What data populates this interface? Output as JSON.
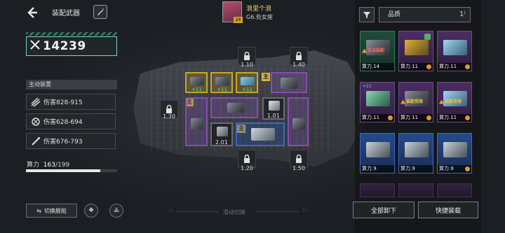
{
  "header": {
    "back_icon": "back-arrow-icon",
    "title": "装配武器",
    "action_icon": "pen-icon"
  },
  "power": {
    "value": "14239",
    "icon": "crossed-swords-icon"
  },
  "gear": {
    "title": "主动装置",
    "items": [
      {
        "label": "伤害828-915",
        "icon": "triple-missile-icon"
      },
      {
        "label": "伤害628-694",
        "icon": "claw-icon"
      },
      {
        "label": "伤害676-793",
        "icon": "needle-icon"
      }
    ]
  },
  "capacity": {
    "label": "算力",
    "used": "163",
    "total": "/199",
    "fraction": 0.819
  },
  "bottom_left": {
    "switch_ship": "切换舰船"
  },
  "player": {
    "name": "浪里个浪",
    "title": "G6.处女座",
    "level": "24"
  },
  "ship": {
    "locks": [
      {
        "value": "1.10"
      },
      {
        "value": "1.40"
      },
      {
        "value": "1.30"
      },
      {
        "value": "1.20"
      },
      {
        "value": "1.50"
      }
    ],
    "slot_values": {
      "a": "2.01",
      "b": "1.01"
    },
    "main_tag": "主",
    "plus_tags": [
      "+11",
      "+11",
      "+11"
    ]
  },
  "swipe_hint": "滑动切换",
  "right": {
    "quality_label": "品质",
    "cards": [
      {
        "cap": "算力.14",
        "warn": "无法装配",
        "variant": "green"
      },
      {
        "cap": "算力.11",
        "warn": "",
        "variant": "purple"
      },
      {
        "cap": "算力.11",
        "warn": "",
        "variant": "purple"
      },
      {
        "cap": "算力.11",
        "warn": "",
        "variant": "purple"
      },
      {
        "cap": "算力.11",
        "warn": "装配受限",
        "variant": "purple"
      },
      {
        "cap": "算力.11",
        "warn": "装配受限",
        "variant": "purple"
      },
      {
        "cap": "算力.9",
        "warn": "",
        "variant": "blue"
      },
      {
        "cap": "算力.9",
        "warn": "",
        "variant": "blue"
      },
      {
        "cap": "算力.9",
        "warn": "",
        "variant": "blue"
      }
    ],
    "unload_all": "全部卸下",
    "quick_equip": "快捷装载"
  },
  "colors": {
    "accent": "#7fd6b8",
    "purple": "#8b4bb2",
    "gold": "#c9a72a",
    "blue": "#3f66c8"
  }
}
